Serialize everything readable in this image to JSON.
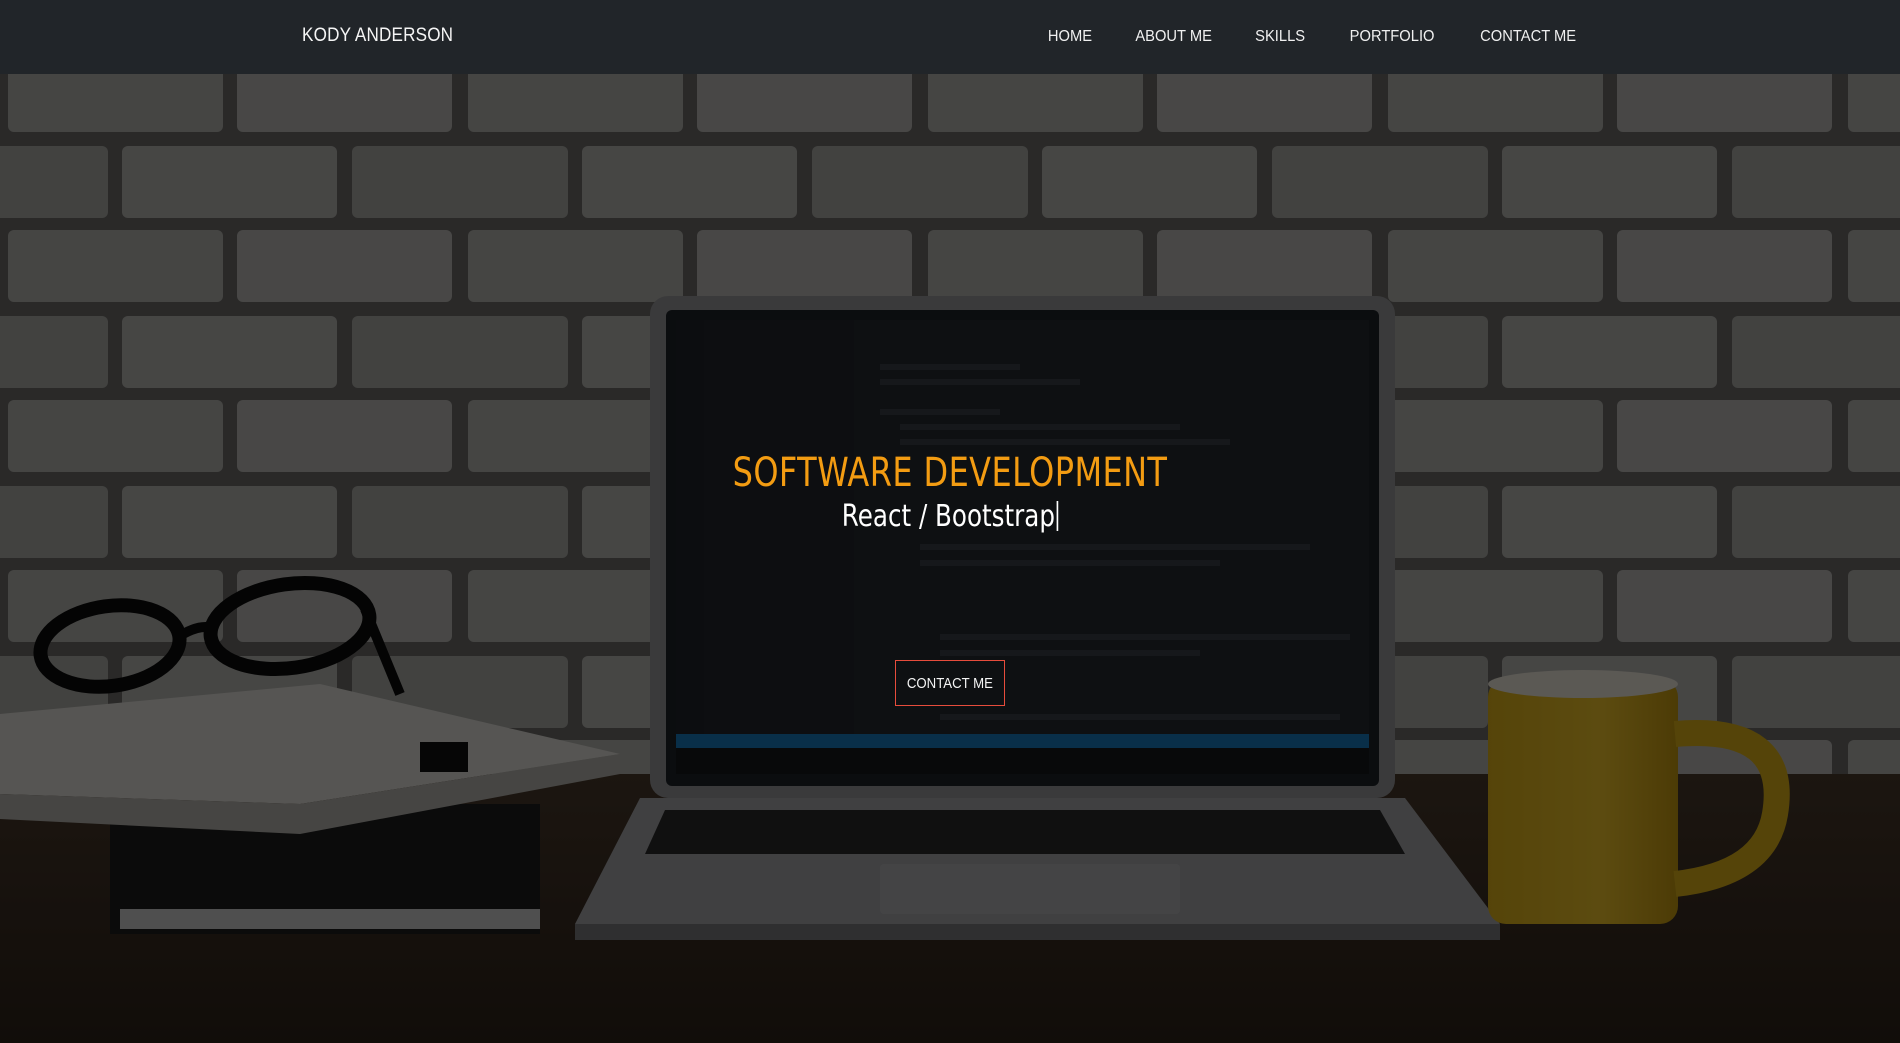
{
  "navbar": {
    "brand": "KODY ANDERSON",
    "links": [
      "HOME",
      "ABOUT ME",
      "SKILLS",
      "PORTFOLIO",
      "CONTACT ME"
    ],
    "background_color": "#212529"
  },
  "hero": {
    "title": "SOFTWARE DEVELOPMENT",
    "subtitle": "React / Bootstrap",
    "cta_label": "CONTACT ME",
    "title_color": "#f39c12",
    "cta_border_color": "#e74c3c",
    "background_image": "brick-wall-desk-laptop-photo"
  }
}
